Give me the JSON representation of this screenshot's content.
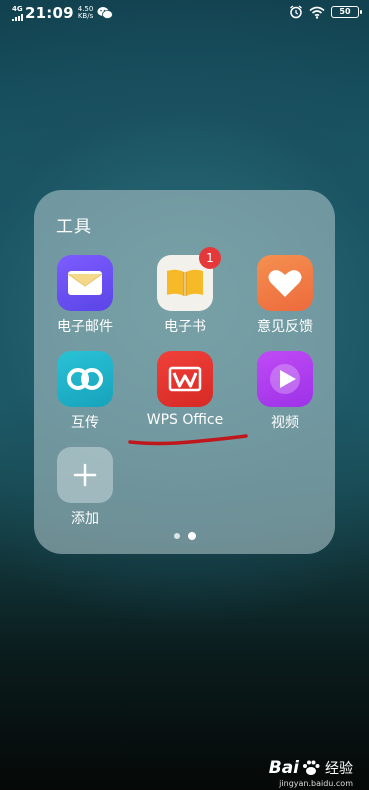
{
  "status_bar": {
    "network": "4G",
    "time": "21:09",
    "speed_value": "4.50",
    "speed_unit": "KB/s",
    "battery": "50",
    "icons": [
      "signal-icon",
      "wechat-icon",
      "alarm-icon",
      "wifi-icon",
      "battery-icon"
    ]
  },
  "folder": {
    "title": "工具",
    "apps": [
      {
        "label": "电子邮件",
        "icon": "mail-icon",
        "color": "#6a4ef0"
      },
      {
        "label": "电子书",
        "icon": "book-icon",
        "color": "#f4f1ea",
        "badge": "1"
      },
      {
        "label": "意见反馈",
        "icon": "heart-icon",
        "color": "#f07a48"
      },
      {
        "label": "互传",
        "icon": "link-rings-icon",
        "color": "#21b2c9"
      },
      {
        "label": "WPS Office",
        "icon": "wps-icon",
        "color": "#e8332e"
      },
      {
        "label": "视频",
        "icon": "play-icon",
        "color": "#b83ef0"
      },
      {
        "label": "添加",
        "icon": "plus-icon",
        "color": "#cfdbe0"
      }
    ],
    "page_indicator": {
      "pages": 2,
      "current": 2
    }
  },
  "annotation": {
    "color": "#c0171c"
  },
  "watermark": {
    "brand": "Bai",
    "brand2": "经验",
    "url": "jingyan.baidu.com"
  }
}
